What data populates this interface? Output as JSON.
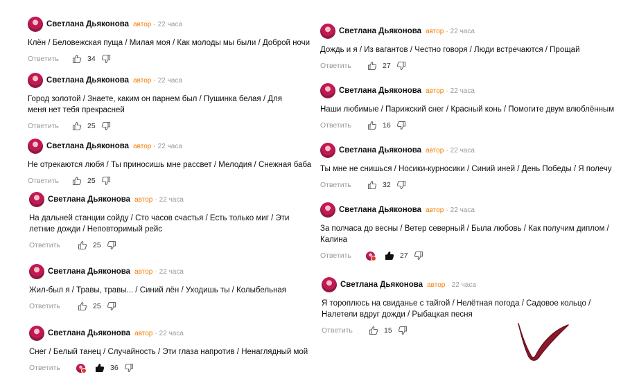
{
  "common": {
    "author": "Светлана Дьяконова",
    "badge": "автор",
    "dot": "·",
    "time": "22 часа",
    "reply": "Ответить"
  },
  "colors": {
    "badge": "#f57c00",
    "avatar": "#c2185b",
    "checkmark": "#8b1a2b"
  },
  "comments": [
    {
      "text": "Клён / Беловежская пуща / Милая моя / Как молоды мы были / Доброй ночи",
      "likes": "34",
      "liked_by_author": false
    },
    {
      "text": "Город золотой / Знаете, каким он парнем был / Пушинка белая / Для меня нет тебя прекрасней",
      "likes": "25",
      "liked_by_author": false
    },
    {
      "text": "Не отрекаются любя / Ты приносишь мне рассвет / Мелодия / Снежная баба",
      "likes": "25",
      "liked_by_author": false
    },
    {
      "text": "На дальней станции сойду / Сто часов счастья / Есть только миг / Эти летние дожди / Неповторимый рейс",
      "likes": "25",
      "liked_by_author": false
    },
    {
      "text": "Жил-был я / Травы, травы... / Синий лён / Уходишь ты / Колыбельная",
      "likes": "25",
      "liked_by_author": false
    },
    {
      "text": "Снег / Белый танец / Случайность / Эти глаза напротив / Ненаглядный мой",
      "likes": "36",
      "liked_by_author": true
    },
    {
      "text": "Дождь и я / Из вагантов / Честно говоря / Люди встречаются / Прощай",
      "likes": "27",
      "liked_by_author": false
    },
    {
      "text": "Наши любимые / Парижский снег / Красный конь / Помогите двум влюблённым",
      "likes": "16",
      "liked_by_author": false
    },
    {
      "text": "Ты мне не снишься / Носики-курносики / Синий иней / День Победы / Я полечу",
      "likes": "32",
      "liked_by_author": false
    },
    {
      "text": "За полчаса до весны / Ветер северный / Была любовь / Как получим диплом / Калина",
      "likes": "27",
      "liked_by_author": true
    },
    {
      "text": "Я тороплюсь на свиданье с тайгой / Нелётная погода / Садовое кольцо / Налетели вдруг дожди / Рыбацкая песня",
      "likes": "15",
      "liked_by_author": false
    }
  ]
}
